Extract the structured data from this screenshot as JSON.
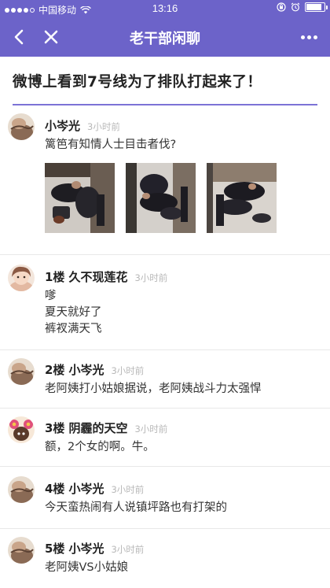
{
  "status_bar": {
    "carrier": "中国移动",
    "time": "13:16",
    "battery_level": 0.85,
    "signal_bars": 4,
    "icons": [
      "wifi-icon",
      "lock-rotation-icon",
      "alarm-icon",
      "battery-icon"
    ]
  },
  "nav": {
    "title": "老干部闲聊",
    "icons": [
      "back-chevron-icon",
      "close-icon",
      "more-icon"
    ],
    "bar_color": "#6c63c9"
  },
  "topic": {
    "title": "微博上看到7号线为了排队打起来了！",
    "accent_color": "#7c73d6"
  },
  "posts": [
    {
      "floor": "",
      "author": "小岑光",
      "time": "3小时前",
      "lines": [
        "篱笆有知情人士目击者伐?"
      ],
      "photos": [
        "subway-fight-photo",
        "subway-fight-photo",
        "subway-fight-photo"
      ],
      "avatar": "avatar-brown"
    },
    {
      "floor": "1楼",
      "author": "久不现莲花",
      "time": "3小时前",
      "lines": [
        "嗲",
        "夏天就好了",
        "裤衩满天飞"
      ],
      "avatar": "avatar-girl"
    },
    {
      "floor": "2楼",
      "author": "小岑光",
      "time": "3小时前",
      "lines": [
        "老阿姨打小姑娘据说，老阿姨战斗力太强悍"
      ],
      "avatar": "avatar-brown"
    },
    {
      "floor": "3楼",
      "author": "阴霾的天空",
      "time": "3小时前",
      "lines": [
        "额，2个女的啊。牛。"
      ],
      "avatar": "avatar-flowers"
    },
    {
      "floor": "4楼",
      "author": "小岑光",
      "time": "3小时前",
      "lines": [
        "今天蛮热闹有人说镇坪路也有打架的"
      ],
      "avatar": "avatar-brown"
    },
    {
      "floor": "5楼",
      "author": "小岑光",
      "time": "3小时前",
      "lines": [
        "老阿姨VS小姑娘"
      ],
      "avatar": "avatar-brown"
    }
  ]
}
